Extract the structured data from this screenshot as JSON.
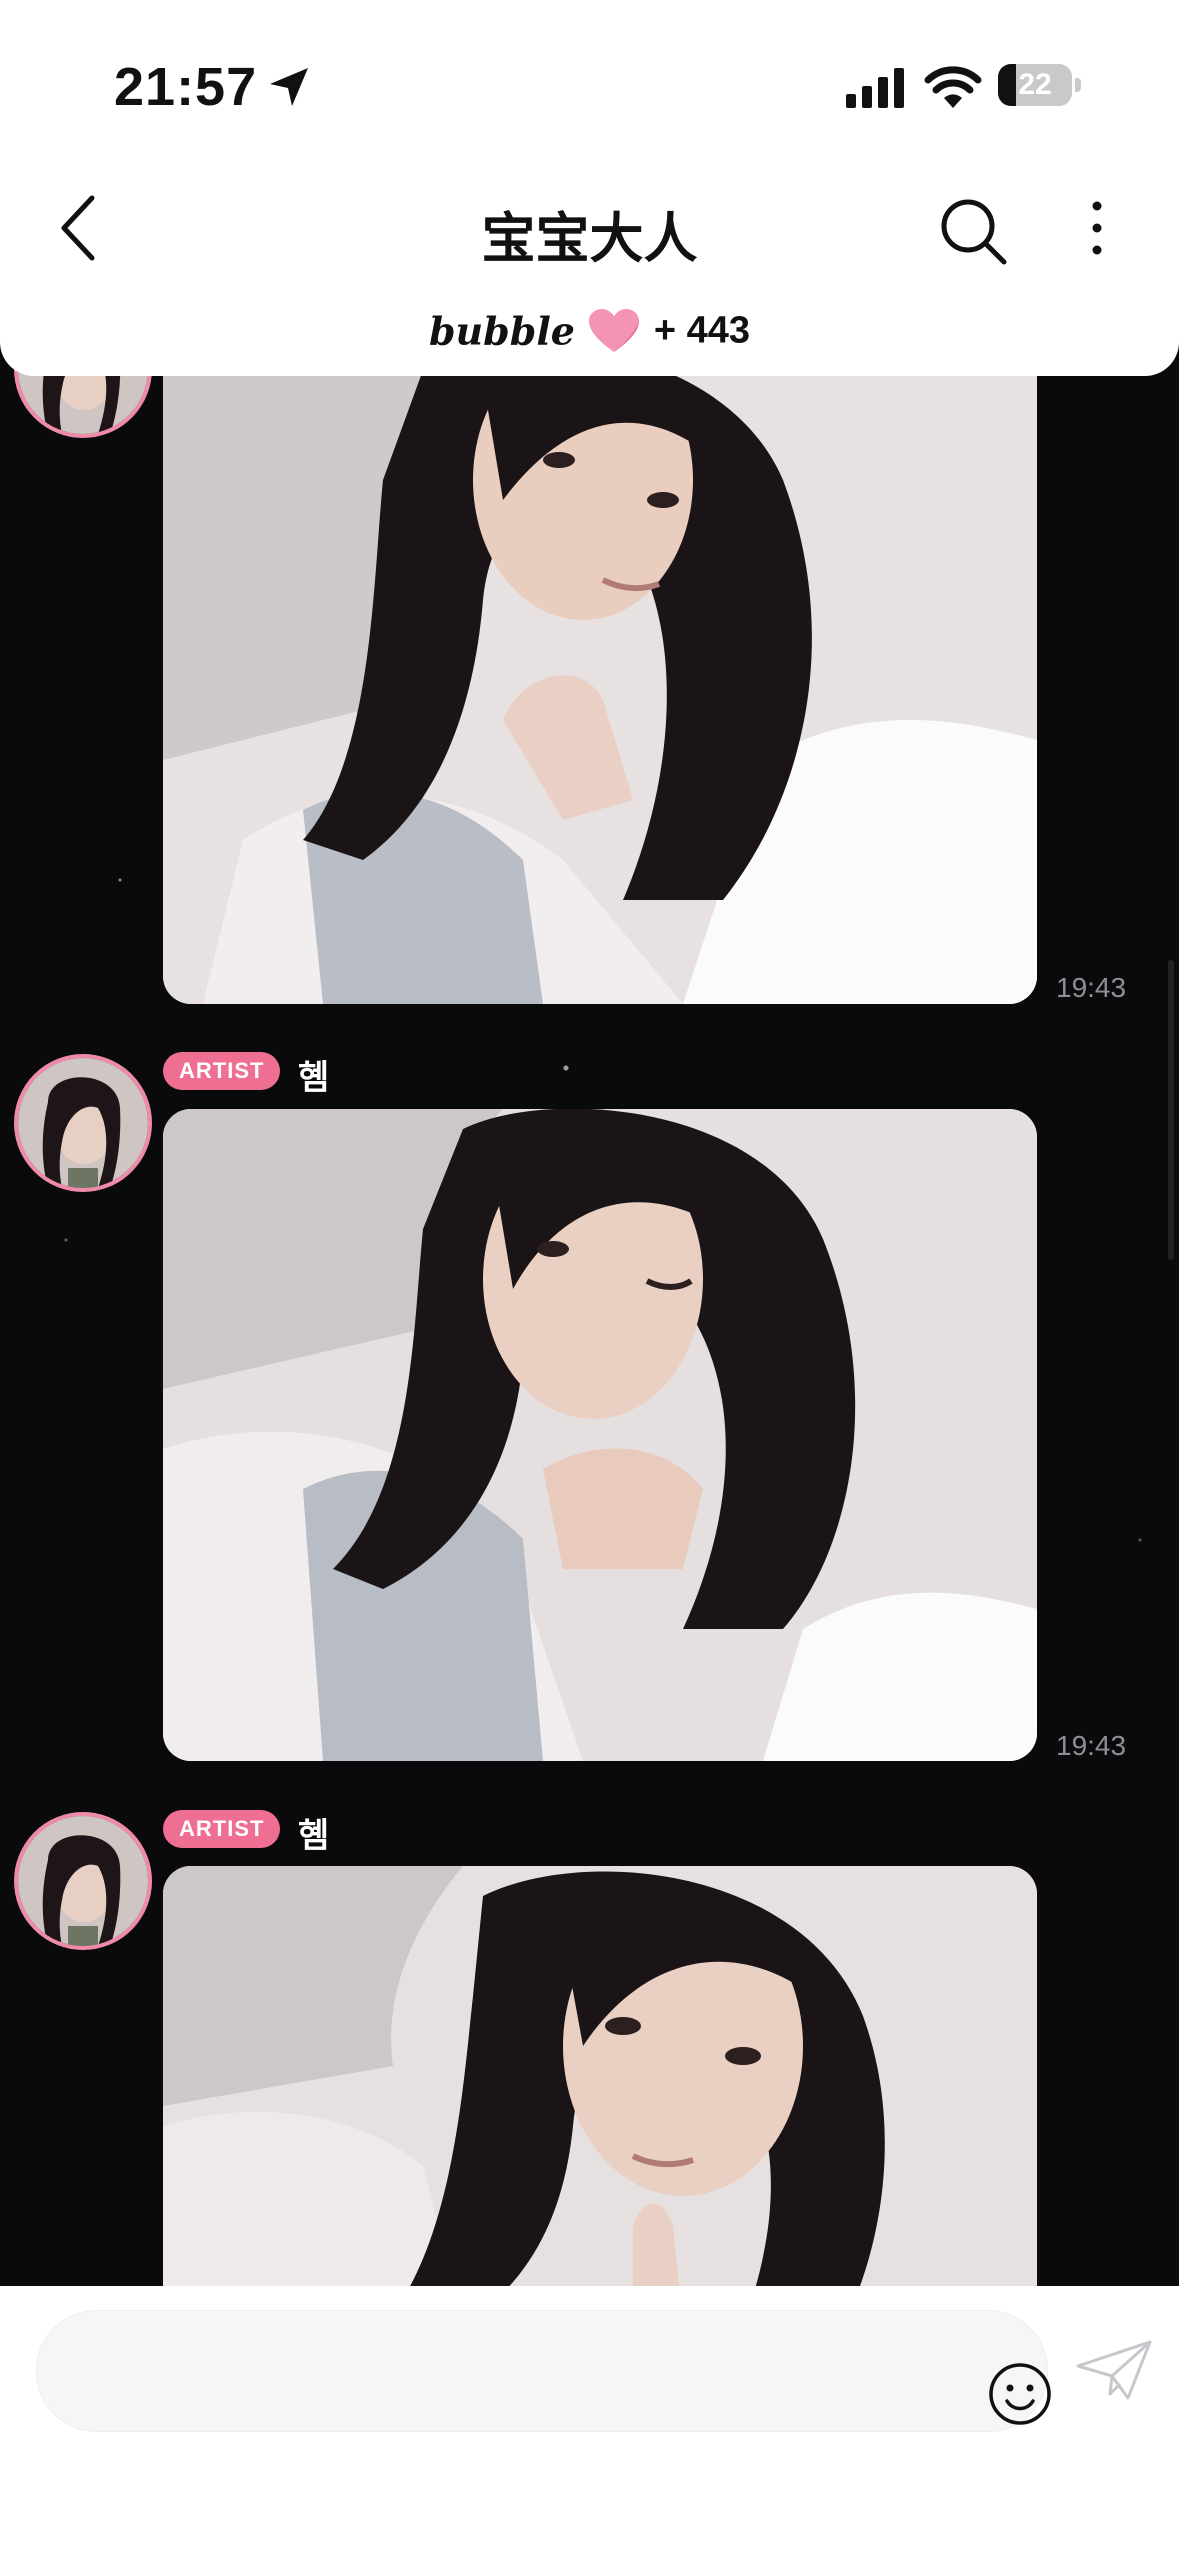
{
  "status_bar": {
    "time": "21:57",
    "battery": "22",
    "icons": [
      "location-arrow-icon",
      "signal-icon",
      "wifi-icon",
      "battery-icon"
    ]
  },
  "header": {
    "title": "宝宝大人",
    "bubble_label": "bubble",
    "bubble_count": "+ 443",
    "icons": [
      "back-chevron-icon",
      "search-icon",
      "more-vertical-icon",
      "heart-icon"
    ]
  },
  "messages": [
    {
      "badge": "",
      "sender": "",
      "time": "19:43"
    },
    {
      "badge": "ARTIST",
      "sender": "혬",
      "time": "19:43"
    },
    {
      "badge": "ARTIST",
      "sender": "혬",
      "time": ""
    }
  ],
  "composer": {
    "placeholder": "",
    "icons": [
      "emoji-icon",
      "send-icon"
    ]
  },
  "colors": {
    "accent_pink": "#ef6f92",
    "avatar_ring": "#f08aa9",
    "chat_bg": "#0a0a0c",
    "timestamp": "#8f8f93"
  }
}
